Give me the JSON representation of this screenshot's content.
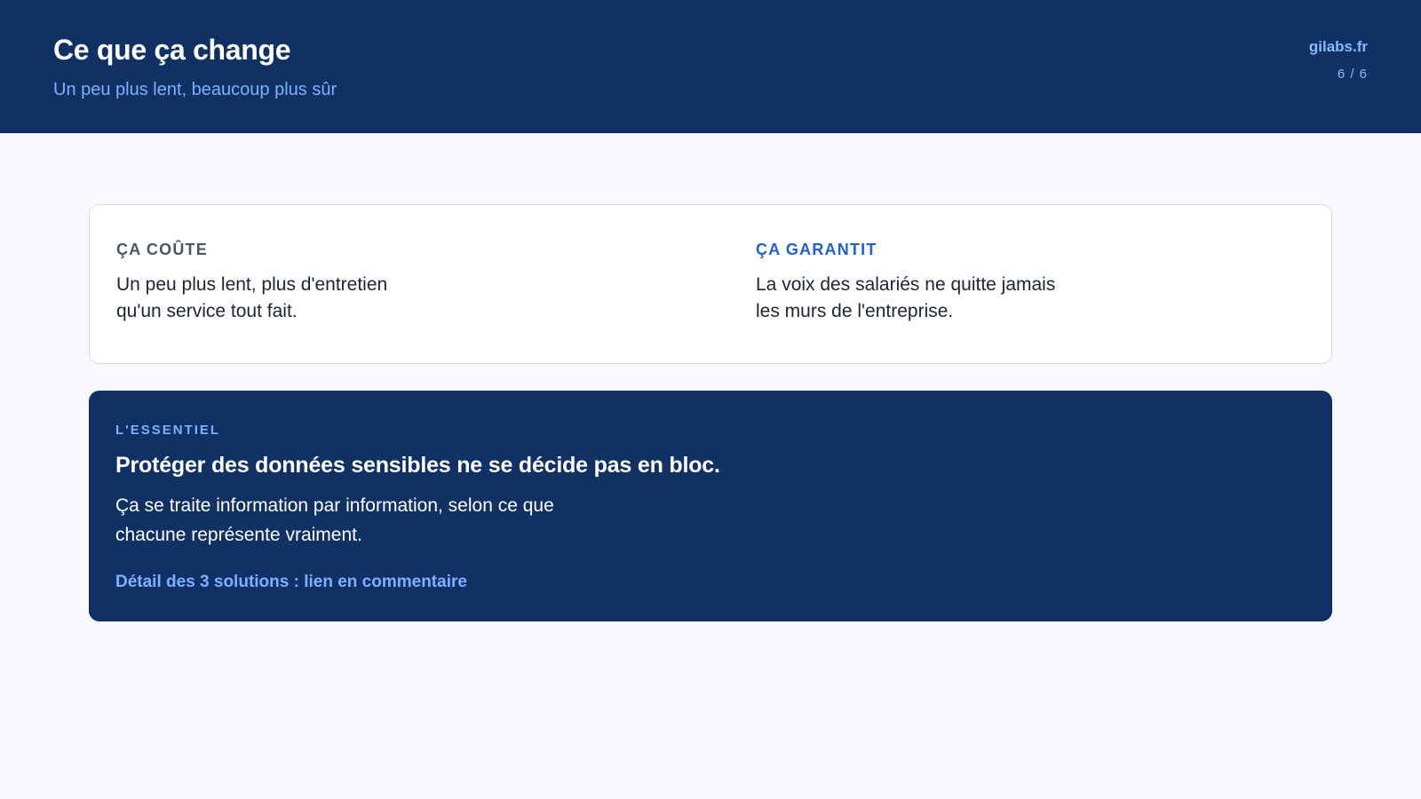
{
  "header": {
    "title": "Ce que ça change",
    "subtitle": "Un peu plus lent, beaucoup plus sûr",
    "brand": "gilabs.fr",
    "page_counter": "6 / 6"
  },
  "comparison": {
    "cost": {
      "label": "ÇA COÛTE",
      "text": "Un peu plus lent, plus d'entretien qu'un service tout fait."
    },
    "guarantee": {
      "label": "ÇA GARANTIT",
      "text": "La voix des salariés ne quitte jamais les murs de l'entreprise."
    }
  },
  "essential": {
    "label": "L'ESSENTIEL",
    "headline": "Protéger des données sensibles ne se décide pas en bloc.",
    "body": "Ça se traite information par information, selon ce que chacune représente vraiment.",
    "link": "Détail des 3 solutions : lien en commentaire"
  },
  "colors": {
    "navy": "#0f3163",
    "accent_light_blue": "#7fb0ff",
    "accent_blue": "#1f5fd1",
    "background": "#f6f8fb"
  }
}
